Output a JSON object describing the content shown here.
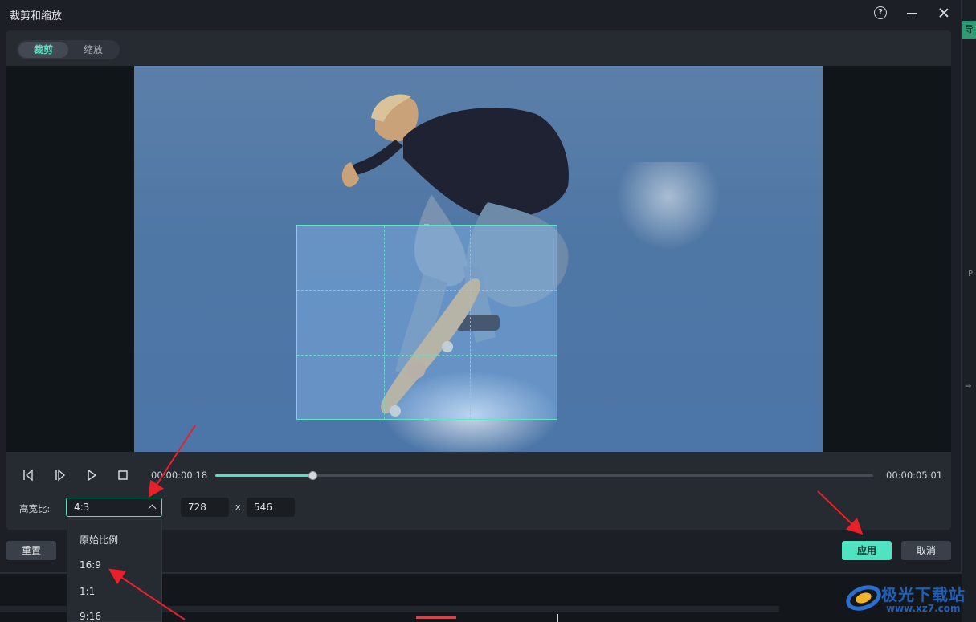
{
  "dialog": {
    "title": "裁剪和缩放",
    "help_icon": "help-circle-icon",
    "minimize_icon": "minimize-icon",
    "close_icon": "close-icon"
  },
  "tabs": [
    {
      "label": "裁剪",
      "active": true
    },
    {
      "label": "缩放",
      "active": false
    }
  ],
  "player": {
    "current_time": "00:00:00:18",
    "end_time": "00:00:05:01",
    "progress": 0.148,
    "buttons": [
      "prev-frame-icon",
      "next-frame-icon",
      "play-icon",
      "stop-icon"
    ]
  },
  "ratio": {
    "label": "高宽比:",
    "selected": "4:3",
    "width": "728",
    "separator": "x",
    "height": "546",
    "options": [
      "原始比例",
      "16:9",
      "1:1",
      "9:16"
    ]
  },
  "buttons": {
    "reset": "重置",
    "apply": "应用",
    "cancel": "取消"
  },
  "background_app": {
    "right_tab_label": "导",
    "right_letter": "P",
    "right_arrow": "⇒"
  },
  "watermark": {
    "name": "极光下载站",
    "url": "www.xz7.com"
  },
  "colors": {
    "accent": "#4fe3c1",
    "annotation_arrow": "#e8202a"
  }
}
